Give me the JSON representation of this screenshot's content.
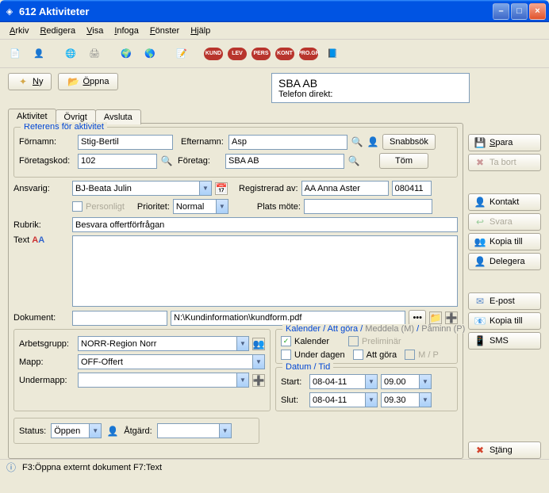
{
  "window": {
    "title": "612 Aktiviteter"
  },
  "menu": {
    "arkiv": "Arkiv",
    "redigera": "Redigera",
    "visa": "Visa",
    "infoga": "Infoga",
    "fonster": "Fönster",
    "hjalp": "Hjälp"
  },
  "badges": {
    "kund": "KUND",
    "lev": "LEV",
    "pers": "PERS",
    "kont": "KONT",
    "progr": "PRO.GR"
  },
  "topButtons": {
    "ny": "Ny",
    "oppna": "Öppna"
  },
  "info": {
    "company": "SBA AB",
    "phoneLabel": "Telefon direkt:"
  },
  "tabs": {
    "aktivitet": "Aktivitet",
    "ovrigt": "Övrigt",
    "avsluta": "Avsluta"
  },
  "ref": {
    "legend": "Referens för aktivitet",
    "fornamnLabel": "Förnamn:",
    "fornamn": "Stig-Bertil",
    "efternamnLabel": "Efternamn:",
    "efternamn": "Asp",
    "foretagskodLabel": "Företagskod:",
    "foretagskod": "102",
    "foretagLabel": "Företag:",
    "foretag": "SBA AB",
    "snabbsok": "Snabbsök",
    "tom": "Töm"
  },
  "resp": {
    "ansvarigLabel": "Ansvarig:",
    "ansvarig": "BJ-Beata Julin",
    "personligt": "Personligt",
    "prioritetLabel": "Prioritet:",
    "prioritet": "Normal",
    "registreradLabel": "Registrerad av:",
    "registrerad": "AA Anna Aster",
    "regDate": "080411",
    "platsLabel": "Plats möte:",
    "plats": ""
  },
  "content": {
    "rubrikLabel": "Rubrik:",
    "rubrik": "Besvara offertförfrågan",
    "textLabel": "Text",
    "text": "",
    "dokumentLabel": "Dokument:",
    "dokument1": "",
    "dokument2": "N:\\Kundinformation\\kundform.pdf"
  },
  "grp": {
    "arbetsgruppLabel": "Arbetsgrupp:",
    "arbetsgrupp": "NORR-Region Norr",
    "mappLabel": "Mapp:",
    "mapp": "OFF-Offert",
    "undermappLabel": "Undermapp:",
    "undermapp": ""
  },
  "status": {
    "statusLabel": "Status:",
    "status": "Öppen",
    "atgardLabel": "Åtgärd:",
    "atgard": ""
  },
  "cal": {
    "header": "Kalender / Att göra /",
    "meddela": "Meddela (M)",
    "paminn": "Påminn (P)",
    "kalender": "Kalender",
    "preliminar": "Preliminär",
    "underDagen": "Under dagen",
    "attGora": "Att göra",
    "mp": "M / P",
    "datumLegend": "Datum / Tid",
    "startLabel": "Start:",
    "startDate": "08-04-11",
    "startTime": "09.00",
    "slutLabel": "Slut:",
    "slutDate": "08-04-11",
    "slutTime": "09.30"
  },
  "side": {
    "spara": "Spara",
    "tabort": "Ta bort",
    "kontakt": "Kontakt",
    "svara": "Svara",
    "kopiaTill1": "Kopia till",
    "delegera": "Delegera",
    "epost": "E-post",
    "kopiaTill2": "Kopia till",
    "sms": "SMS",
    "stang": "Stäng"
  },
  "statusbar": "F3:Öppna externt dokument  F7:Text"
}
